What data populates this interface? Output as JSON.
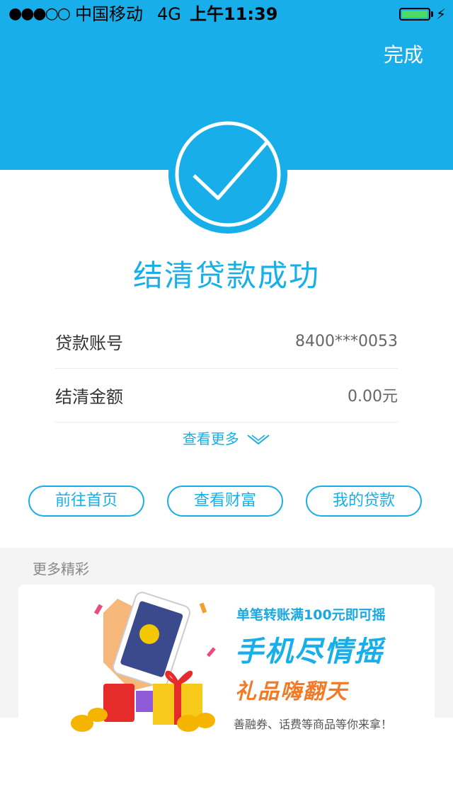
{
  "status_bar": {
    "signal": "●●●○○",
    "carrier": "中国移动",
    "network": "4G",
    "time": "上午11:39",
    "battery_level": 1.0
  },
  "header": {
    "done_label": "完成",
    "color": "#17aee9"
  },
  "result": {
    "icon": "check-icon",
    "title": "结清贷款成功"
  },
  "details": [
    {
      "label": "贷款账号",
      "value": "8400***0053"
    },
    {
      "label": "结清金额",
      "value": "0.00元"
    }
  ],
  "more_link": {
    "label": "查看更多"
  },
  "actions": {
    "home": "前往首页",
    "wealth": "查看财富",
    "loans": "我的贷款"
  },
  "more_section": {
    "title": "更多精彩"
  },
  "banner": {
    "line1": "单笔转账满100元即可摇",
    "line2": "手机尽情摇",
    "line3": "礼品嗨翻天",
    "line4": "善融券、话费等商品等你来拿！"
  }
}
